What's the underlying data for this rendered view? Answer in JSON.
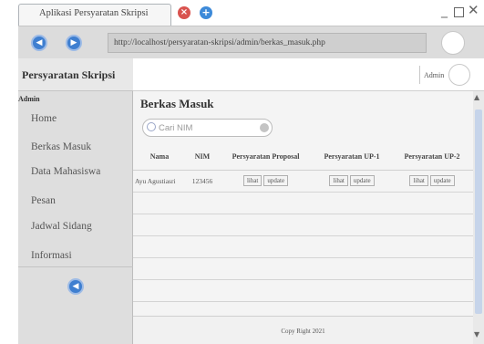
{
  "browser": {
    "tab_title": "Aplikasi Persyaratan Skripsi",
    "close_glyph": "×",
    "new_tab_glyph": "+",
    "url": "http://localhost/persyaratan-skripsi/admin/berkas_masuk.php",
    "back_glyph": "◀",
    "forward_glyph": "▶"
  },
  "sidebar": {
    "title": "Persyaratan Skripsi",
    "role": "Admin",
    "items": [
      {
        "label": "Home"
      },
      {
        "label": "Berkas Masuk"
      },
      {
        "label": "Data Mahasiswa"
      },
      {
        "label": "Pesan"
      },
      {
        "label": "Jadwal Sidang"
      },
      {
        "label": "Informasi"
      }
    ],
    "bottom_icon_glyph": "◀"
  },
  "header": {
    "user_label": "Admin"
  },
  "main": {
    "page_title": "Berkas Masuk",
    "search_placeholder": "Cari NIM",
    "table": {
      "columns": [
        "Nama",
        "NIM",
        "Persyaratan Proposal",
        "Persyaratan UP-1",
        "Persyaratan UP-2"
      ],
      "rows": [
        {
          "nama": "Ayu Agustiasri",
          "nim": "123456",
          "proposal": {
            "view": "lihat",
            "update": "update"
          },
          "up1": {
            "view": "lihat",
            "update": "update"
          },
          "up2": {
            "view": "lihat",
            "update": "update"
          }
        }
      ]
    },
    "footer": "Copy Right 2021"
  },
  "scrollbar": {
    "up_glyph": "▲",
    "down_glyph": "▼"
  },
  "colors": {
    "accent_blue": "#3f7fd0",
    "close_red": "#d9534f",
    "sidebar_bg": "#dedede"
  }
}
